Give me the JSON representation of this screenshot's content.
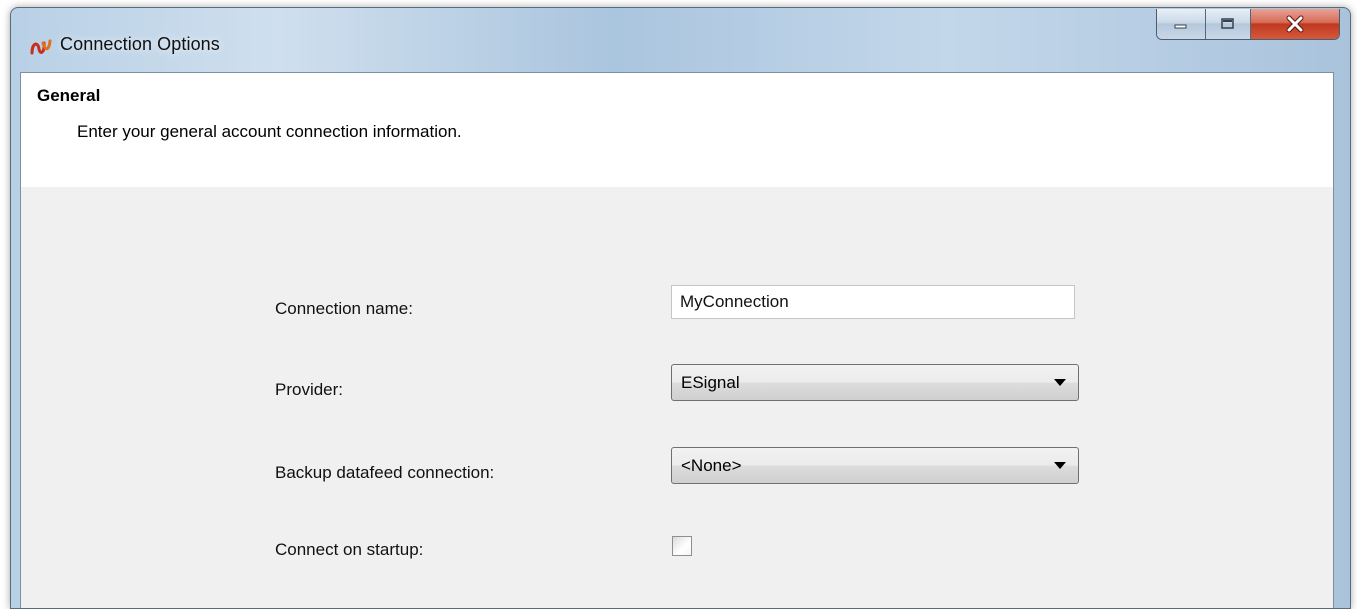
{
  "window": {
    "title": "Connection Options",
    "caption_buttons": {
      "minimize": "minimize-icon",
      "maximize": "maximize-icon",
      "close": "close-icon"
    }
  },
  "section": {
    "title": "General",
    "description": "Enter your general account connection information."
  },
  "form": {
    "connection_name": {
      "label": "Connection name:",
      "value": "MyConnection"
    },
    "provider": {
      "label": "Provider:",
      "selected": "ESignal"
    },
    "backup": {
      "label": "Backup datafeed connection:",
      "selected": "<None>"
    },
    "connect_on_startup": {
      "label": "Connect on startup:",
      "checked": false
    }
  },
  "colors": {
    "close_button": "#c7402a",
    "panel_background": "#f0f0f0",
    "header_background": "#ffffff"
  }
}
